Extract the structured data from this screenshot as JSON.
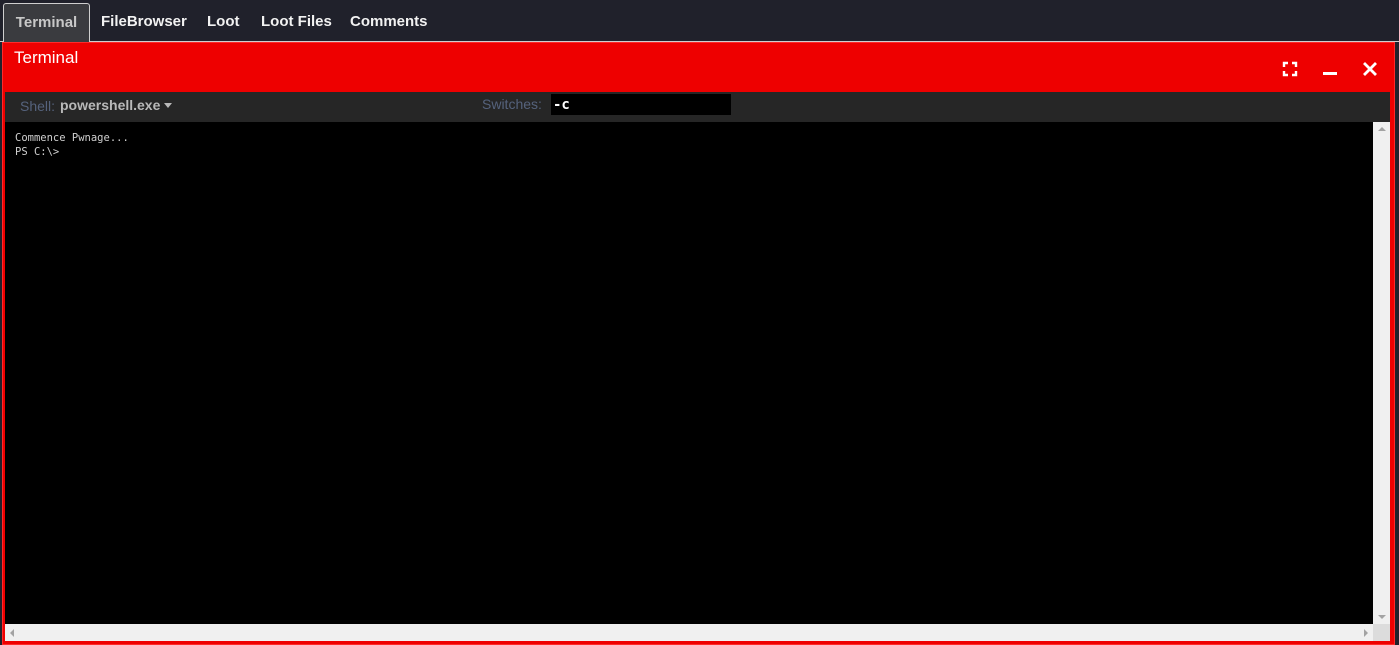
{
  "tabs": [
    {
      "label": "Terminal",
      "active": true
    },
    {
      "label": "FileBrowser",
      "active": false
    },
    {
      "label": "Loot",
      "active": false
    },
    {
      "label": "Loot Files",
      "active": false
    },
    {
      "label": "Comments",
      "active": false
    }
  ],
  "window": {
    "title": "Terminal",
    "accent_color": "#ee0000",
    "controls": [
      "maximize-icon",
      "minimize-icon",
      "close-icon"
    ]
  },
  "toolbar": {
    "shell_label": "Shell:",
    "shell_value": "powershell.exe",
    "switches_label": "Switches:",
    "switches_value": "-c"
  },
  "terminal": {
    "lines": [
      "Commence Pwnage...",
      "PS C:\\>"
    ]
  }
}
